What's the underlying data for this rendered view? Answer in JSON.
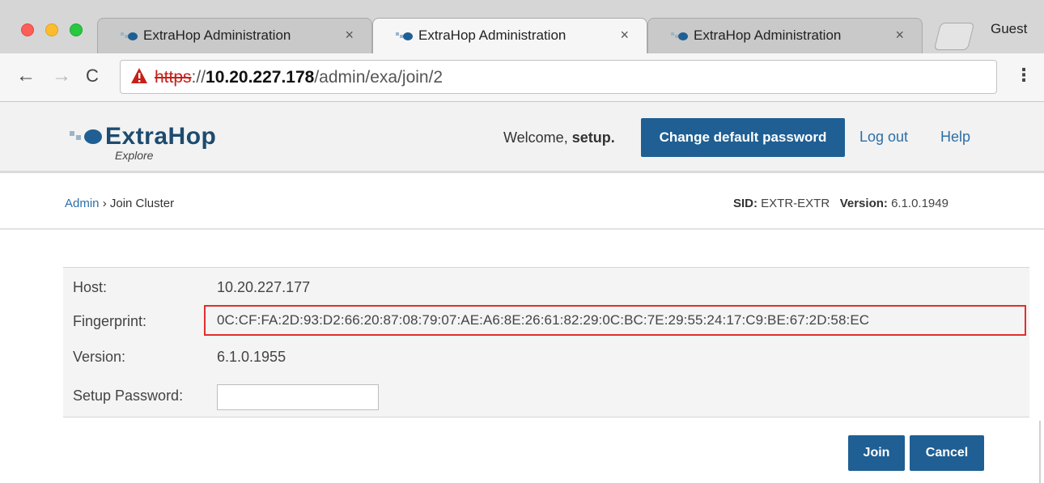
{
  "browser": {
    "tabs": [
      {
        "title": "ExtraHop Administration",
        "close": "×"
      },
      {
        "title": "ExtraHop Administration",
        "close": "×"
      },
      {
        "title": "ExtraHop Administration",
        "close": "×"
      }
    ],
    "active_tab": 1,
    "profile": "Guest",
    "nav": {
      "back": "←",
      "forward": "→",
      "reload": "C",
      "menu": "⋮"
    },
    "url": {
      "scheme": "https",
      "separator": "://",
      "host": "10.20.227.178",
      "path": "/admin/exa/join/2"
    },
    "colors": {
      "insecure": "#c5211a"
    }
  },
  "header": {
    "logo_text": "ExtraHop",
    "logo_sub": "Explore",
    "welcome_prefix": "Welcome, ",
    "welcome_user": "setup.",
    "change_password": "Change default password",
    "logout": "Log out",
    "help": "Help"
  },
  "breadcrumb": {
    "root": "Admin",
    "separator": " › ",
    "current": "Join Cluster"
  },
  "sysinfo": {
    "sid_label": "SID:",
    "sid": "EXTR-EXTR",
    "version_label": "Version:",
    "version": "6.1.0.1949"
  },
  "join": {
    "host_label": "Host:",
    "host": "10.20.227.177",
    "fingerprint_label": "Fingerprint:",
    "fingerprint": "0C:CF:FA:2D:93:D2:66:20:87:08:79:07:AE:A6:8E:26:61:82:29:0C:BC:7E:29:55:24:17:C9:BE:67:2D:58:EC",
    "version_label": "Version:",
    "version": "6.1.0.1955",
    "password_label": "Setup Password:",
    "password_value": ""
  },
  "actions": {
    "join": "Join",
    "cancel": "Cancel"
  },
  "colors": {
    "primary": "#1f5f93",
    "link": "#2c6fa8",
    "highlight": "#e22d2d"
  }
}
